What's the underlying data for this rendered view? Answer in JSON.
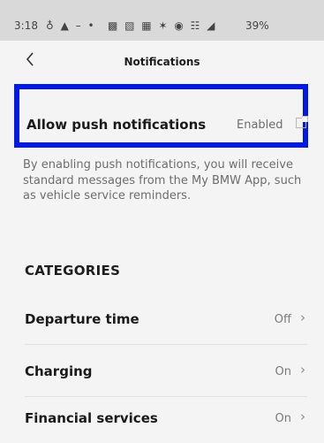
{
  "status_bar": {
    "time": "3:18",
    "left_icons": "♁ ▲ – •",
    "right_icons": "▩ ▧ ▦ ✶ ◉ ☷ ◢",
    "battery": "39%"
  },
  "header": {
    "back_icon": "chevron-left-icon",
    "title": "Notifications"
  },
  "push": {
    "label": "Allow push notifications",
    "status": "Enabled",
    "icon": "external-link-icon",
    "highlight_color": "#0019e6"
  },
  "description": "By enabling push notifications, you will receive standard messages from the My BMW App, such as vehicle service reminders.",
  "categories": {
    "header": "CATEGORIES",
    "items": [
      {
        "label": "Departure time",
        "value": "Off"
      },
      {
        "label": "Charging",
        "value": "On"
      },
      {
        "label": "Financial services",
        "value": "On"
      }
    ]
  }
}
